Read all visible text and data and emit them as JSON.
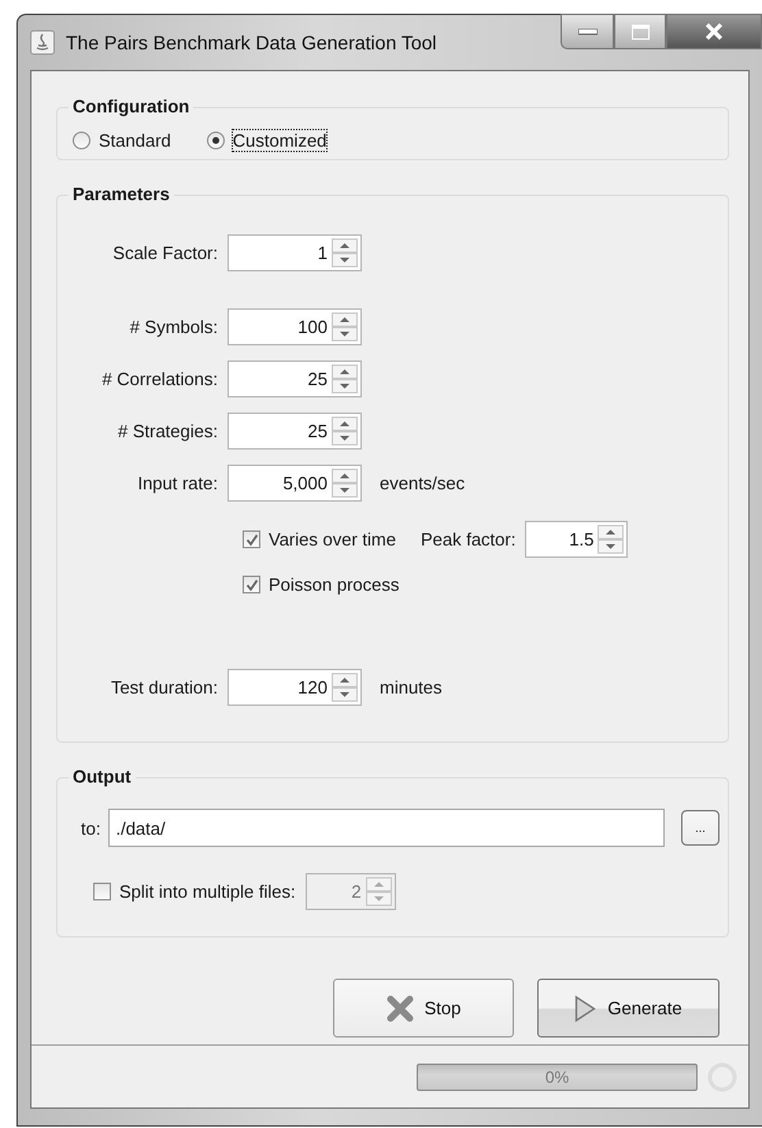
{
  "window": {
    "title": "The Pairs Benchmark Data Generation Tool"
  },
  "configuration": {
    "title": "Configuration",
    "options": [
      {
        "label": "Standard",
        "selected": false
      },
      {
        "label": "Customized",
        "selected": true
      }
    ]
  },
  "parameters": {
    "title": "Parameters",
    "scale": {
      "label": "Scale Factor:",
      "value": "1"
    },
    "fields": [
      {
        "label": "# Symbols:",
        "value": "100"
      },
      {
        "label": "# Correlations:",
        "value": "25"
      },
      {
        "label": "# Strategies:",
        "value": "25"
      },
      {
        "label": "Input rate:",
        "value": "5,000",
        "unit": "events/sec"
      }
    ],
    "options": [
      {
        "label": "Varies over time",
        "checked": true,
        "peak_label": "Peak factor:",
        "peak_value": "1.5"
      },
      {
        "label": "Poisson process",
        "checked": true
      }
    ],
    "duration": {
      "label": "Test duration:",
      "value": "120",
      "unit": "minutes"
    }
  },
  "output": {
    "title": "Output",
    "to_label": "to:",
    "path": "./data/",
    "browse": "...",
    "split": {
      "label": "Split into multiple files:",
      "checked": false,
      "value": "2",
      "disabled": true
    }
  },
  "buttons": [
    {
      "kind": "stop",
      "label": "Stop"
    },
    {
      "kind": "generate",
      "label": "Generate"
    }
  ],
  "progress": {
    "text": "0%",
    "level": 0
  }
}
